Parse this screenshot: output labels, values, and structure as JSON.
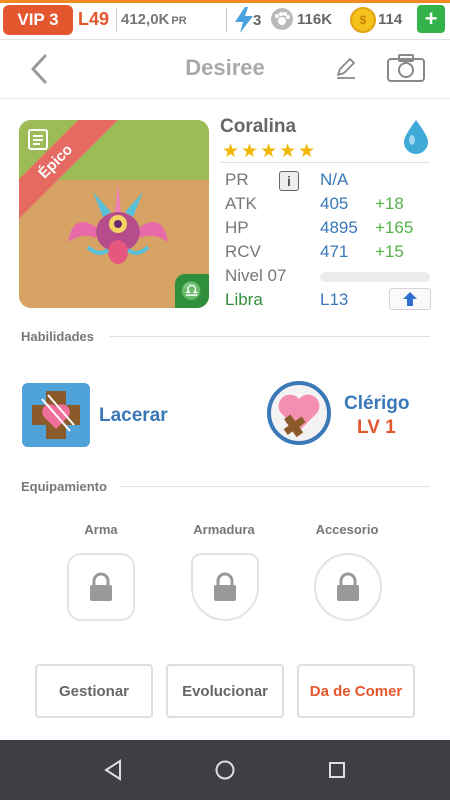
{
  "status": {
    "vip": "VIP 3",
    "level": "L49",
    "power": "412,0K",
    "power_unit": "PR",
    "stamina": "3",
    "paws": "116K",
    "coins": "114",
    "plus": "+"
  },
  "header": {
    "title": "Desiree"
  },
  "monster": {
    "rarity": "Épico",
    "name": "Coralina",
    "stars": "★★★★★",
    "stats": {
      "pr_label": "PR",
      "pr_info": "i",
      "pr_value": "N/A",
      "atk_label": "ATK",
      "atk_value": "405",
      "atk_bonus": "+18",
      "hp_label": "HP",
      "hp_value": "4895",
      "hp_bonus": "+165",
      "rcv_label": "RCV",
      "rcv_value": "471",
      "rcv_bonus": "+15",
      "level_label": "Nivel 07",
      "level_progress": 0.0,
      "zodiac": "Libra",
      "zodiac_level": "L13"
    }
  },
  "skills": {
    "section_label": "Habilidades",
    "skill_name": "Lacerar",
    "class_name": "Clérigo",
    "class_level": "LV 1"
  },
  "equipment": {
    "section_label": "Equipamiento",
    "weapon": "Arma",
    "armor": "Armadura",
    "accessory": "Accesorio"
  },
  "actions": {
    "manage": "Gestionar",
    "evolve": "Evolucionar",
    "feed": "Da de Comer"
  },
  "colors": {
    "accent_blue": "#3a78b8",
    "accent_orange": "#e4572e",
    "green": "#2f8f3c",
    "star_gold": "#f2b705"
  }
}
